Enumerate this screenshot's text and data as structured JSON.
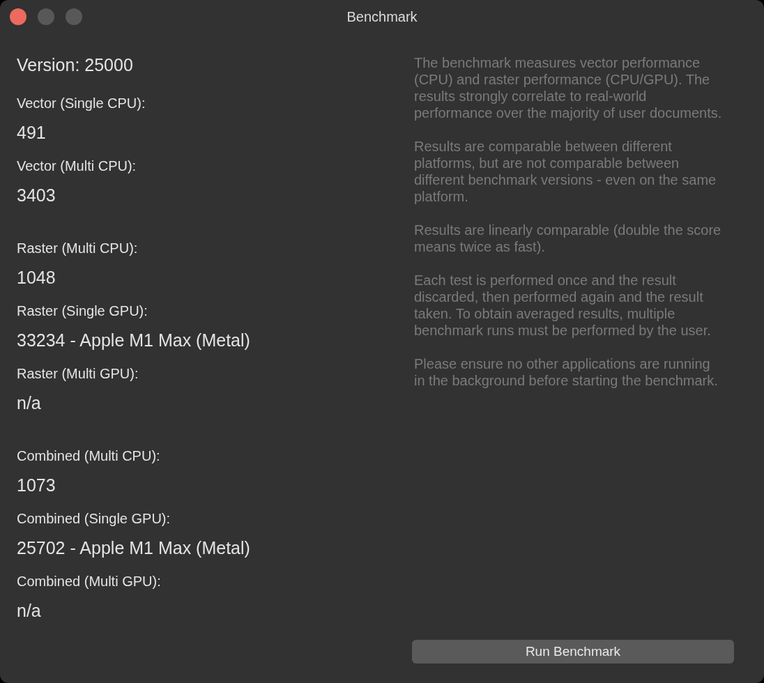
{
  "window": {
    "title": "Benchmark",
    "controls": [
      {
        "kind": "close",
        "disabled": false
      },
      {
        "kind": "minimize",
        "disabled": true
      },
      {
        "kind": "zoom",
        "disabled": true
      }
    ]
  },
  "version": "Version: 25000",
  "groups": [
    {
      "results": [
        {
          "label": "Vector (Single CPU):",
          "value": "491"
        },
        {
          "label": "Vector (Multi CPU):",
          "value": "3403"
        }
      ]
    },
    {
      "results": [
        {
          "label": "Raster (Multi CPU):",
          "value": "1048"
        },
        {
          "label": "Raster (Single GPU):",
          "value": "33234 - Apple M1 Max (Metal)"
        },
        {
          "label": "Raster (Multi GPU):",
          "value": "n/a"
        }
      ]
    },
    {
      "results": [
        {
          "label": "Combined (Multi CPU):",
          "value": "1073"
        },
        {
          "label": "Combined (Single GPU):",
          "value": "25702 - Apple M1 Max (Metal)"
        },
        {
          "label": "Combined (Multi GPU):",
          "value": "n/a"
        }
      ]
    }
  ],
  "description": [
    "The benchmark measures vector performance (CPU) and raster performance (CPU/GPU). The results strongly correlate to real-world performance over the majority of user documents.",
    "Results are comparable between different platforms, but are not comparable between different benchmark versions - even on the same platform.",
    "Results are linearly comparable (double the score means twice as fast).",
    "Each test is performed once and the result discarded, then performed again and the result taken. To obtain averaged results, multiple benchmark runs must be performed by the user.",
    "Please ensure no other applications are running in the background before starting the benchmark."
  ],
  "run_button": "Run Benchmark"
}
